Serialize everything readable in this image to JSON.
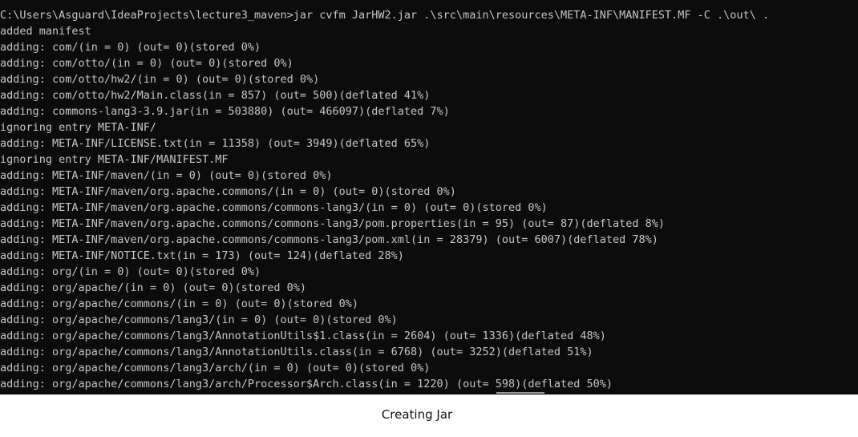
{
  "terminal": {
    "background": "#0c0c0c",
    "text_color": "#c6c6c6",
    "lines": [
      "C:\\Users\\Asguard\\IdeaProjects\\lecture3_maven>jar cvfm JarHW2.jar .\\src\\main\\resources\\META-INF\\MANIFEST.MF -C .\\out\\ .",
      "added manifest",
      "adding: com/(in = 0) (out= 0)(stored 0%)",
      "adding: com/otto/(in = 0) (out= 0)(stored 0%)",
      "adding: com/otto/hw2/(in = 0) (out= 0)(stored 0%)",
      "adding: com/otto/hw2/Main.class(in = 857) (out= 500)(deflated 41%)",
      "adding: commons-lang3-3.9.jar(in = 503880) (out= 466097)(deflated 7%)",
      "ignoring entry META-INF/",
      "adding: META-INF/LICENSE.txt(in = 11358) (out= 3949)(deflated 65%)",
      "ignoring entry META-INF/MANIFEST.MF",
      "adding: META-INF/maven/(in = 0) (out= 0)(stored 0%)",
      "adding: META-INF/maven/org.apache.commons/(in = 0) (out= 0)(stored 0%)",
      "adding: META-INF/maven/org.apache.commons/commons-lang3/(in = 0) (out= 0)(stored 0%)",
      "adding: META-INF/maven/org.apache.commons/commons-lang3/pom.properties(in = 95) (out= 87)(deflated 8%)",
      "adding: META-INF/maven/org.apache.commons/commons-lang3/pom.xml(in = 28379) (out= 6007)(deflated 78%)",
      "adding: META-INF/NOTICE.txt(in = 173) (out= 124)(deflated 28%)",
      "adding: org/(in = 0) (out= 0)(stored 0%)",
      "adding: org/apache/(in = 0) (out= 0)(stored 0%)",
      "adding: org/apache/commons/(in = 0) (out= 0)(stored 0%)",
      "adding: org/apache/commons/lang3/(in = 0) (out= 0)(stored 0%)",
      "adding: org/apache/commons/lang3/AnnotationUtils$1.class(in = 2604) (out= 1336)(deflated 48%)",
      "adding: org/apache/commons/lang3/AnnotationUtils.class(in = 6768) (out= 3252)(deflated 51%)",
      "adding: org/apache/commons/lang3/arch/(in = 0) (out= 0)(stored 0%)",
      "adding: org/apache/commons/lang3/arch/Processor$Arch.class(in = 1220) (out= 598)(deflated 50%)"
    ]
  },
  "caption": "Creating Jar"
}
